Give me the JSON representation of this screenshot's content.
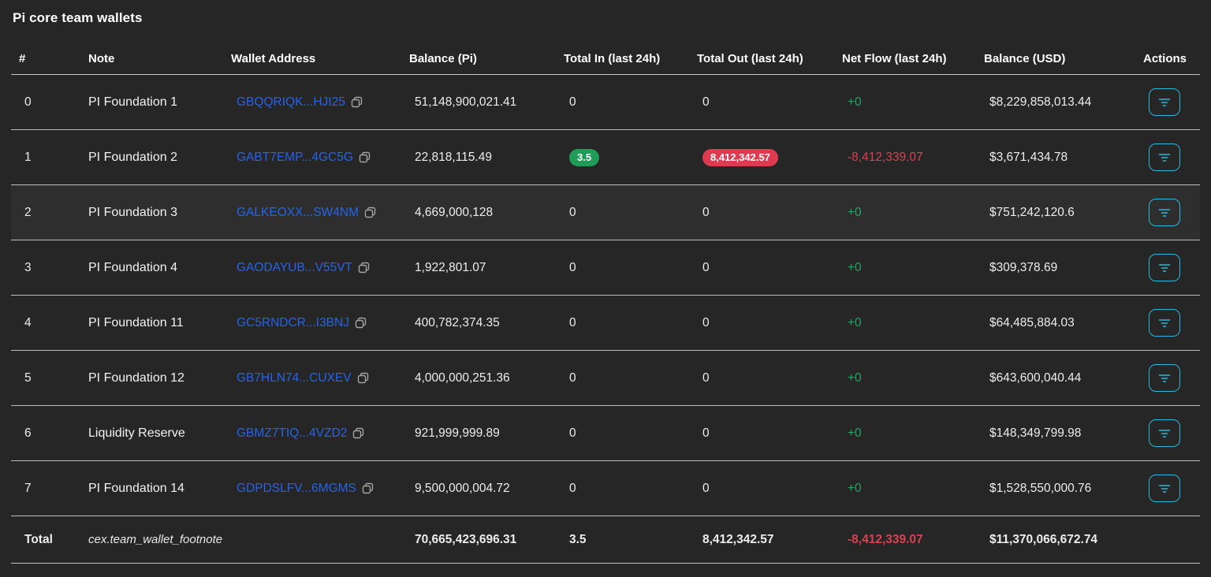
{
  "title": "Pi core team wallets",
  "colors": {
    "accent_cyan": "#2ab7d9",
    "link_blue": "#2563eb",
    "positive_green": "#28a263",
    "negative_red": "#dc4050",
    "badge_green": "#1f9d58",
    "badge_red": "#df3b50"
  },
  "icons": {
    "copy_icon": "⧉",
    "filter_icon": "≡"
  },
  "table": {
    "columns": {
      "index": "#",
      "note": "Note",
      "wallet": "Wallet Address",
      "balance_pi": "Balance (Pi)",
      "total_in": "Total In (last 24h)",
      "total_out": "Total Out (last 24h)",
      "net_flow": "Net Flow (last 24h)",
      "balance_usd": "Balance (USD)",
      "actions": "Actions"
    },
    "rows": [
      {
        "index": "0",
        "note": "PI Foundation 1",
        "wallet": "GBQQRIQK...HJI25",
        "balance_pi": "51,148,900,021.41",
        "total_in": "0",
        "total_in_class": "",
        "total_out": "0",
        "total_out_class": "",
        "net_flow": "+0",
        "net_flow_class": "pos",
        "balance_usd": "$8,229,858,013.44",
        "row_class": ""
      },
      {
        "index": "1",
        "note": "PI Foundation 2",
        "wallet": "GABT7EMP...4GC5G",
        "balance_pi": "22,818,115.49",
        "total_in": "3.5",
        "total_in_class": "badge badge-green",
        "total_out": "8,412,342.57",
        "total_out_class": "badge badge-red",
        "net_flow": "-8,412,339.07",
        "net_flow_class": "neg",
        "balance_usd": "$3,671,434.78",
        "row_class": ""
      },
      {
        "index": "2",
        "note": "PI Foundation 3",
        "wallet": "GALKEOXX...SW4NM",
        "balance_pi": "4,669,000,128",
        "total_in": "0",
        "total_in_class": "",
        "total_out": "0",
        "total_out_class": "",
        "net_flow": "+0",
        "net_flow_class": "pos",
        "balance_usd": "$751,242,120.6",
        "row_class": "highlight"
      },
      {
        "index": "3",
        "note": "PI Foundation 4",
        "wallet": "GAODAYUB...V55VT",
        "balance_pi": "1,922,801.07",
        "total_in": "0",
        "total_in_class": "",
        "total_out": "0",
        "total_out_class": "",
        "net_flow": "+0",
        "net_flow_class": "pos",
        "balance_usd": "$309,378.69",
        "row_class": ""
      },
      {
        "index": "4",
        "note": "PI Foundation 11",
        "wallet": "GC5RNDCR...I3BNJ",
        "balance_pi": "400,782,374.35",
        "total_in": "0",
        "total_in_class": "",
        "total_out": "0",
        "total_out_class": "",
        "net_flow": "+0",
        "net_flow_class": "pos",
        "balance_usd": "$64,485,884.03",
        "row_class": ""
      },
      {
        "index": "5",
        "note": "PI Foundation 12",
        "wallet": "GB7HLN74...CUXEV",
        "balance_pi": "4,000,000,251.36",
        "total_in": "0",
        "total_in_class": "",
        "total_out": "0",
        "total_out_class": "",
        "net_flow": "+0",
        "net_flow_class": "pos",
        "balance_usd": "$643,600,040.44",
        "row_class": ""
      },
      {
        "index": "6",
        "note": "Liquidity Reserve",
        "wallet": "GBMZ7TIQ...4VZD2",
        "balance_pi": "921,999,999.89",
        "total_in": "0",
        "total_in_class": "",
        "total_out": "0",
        "total_out_class": "",
        "net_flow": "+0",
        "net_flow_class": "pos",
        "balance_usd": "$148,349,799.98",
        "row_class": ""
      },
      {
        "index": "7",
        "note": "PI Foundation 14",
        "wallet": "GDPDSLFV...6MGMS",
        "balance_pi": "9,500,000,004.72",
        "total_in": "0",
        "total_in_class": "",
        "total_out": "0",
        "total_out_class": "",
        "net_flow": "+0",
        "net_flow_class": "pos",
        "balance_usd": "$1,528,550,000.76",
        "row_class": ""
      }
    ],
    "total": {
      "label": "Total",
      "footnote": "cex.team_wallet_footnote",
      "balance_pi": "70,665,423,696.31",
      "total_in": "3.5",
      "total_out": "8,412,342.57",
      "net_flow": "-8,412,339.07",
      "net_flow_class": "neg",
      "balance_usd": "$11,370,066,672.74"
    }
  }
}
